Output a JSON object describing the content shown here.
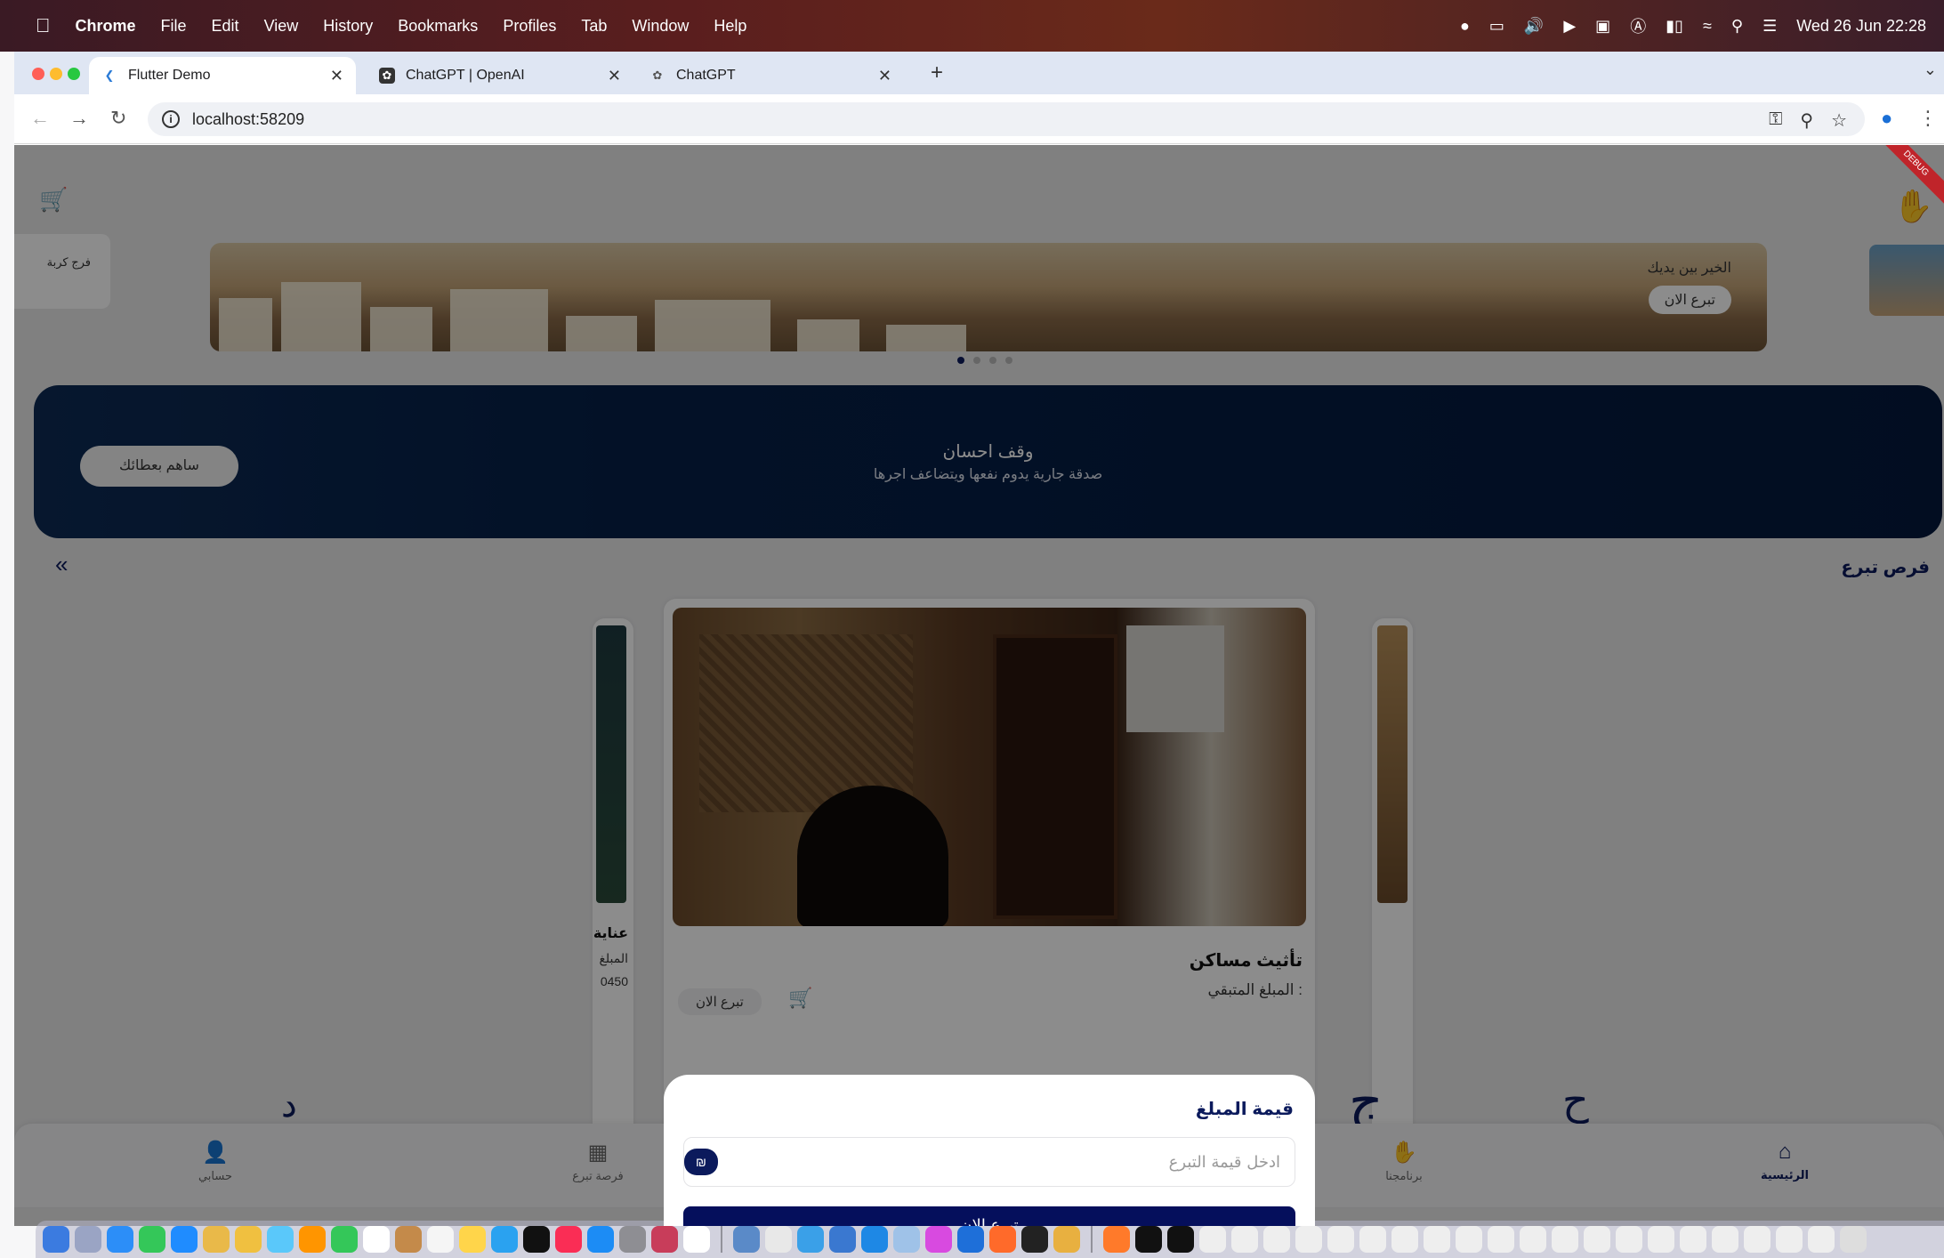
{
  "menubar": {
    "app": "Chrome",
    "items": [
      "File",
      "Edit",
      "View",
      "History",
      "Bookmarks",
      "Profiles",
      "Tab",
      "Window",
      "Help"
    ],
    "clock": "Wed 26 Jun  22:28"
  },
  "browser": {
    "tabs": [
      {
        "title": "Flutter Demo",
        "active": true
      },
      {
        "title": "ChatGPT | OpenAI",
        "active": false
      },
      {
        "title": "ChatGPT",
        "active": false
      }
    ],
    "url": "localhost:58209"
  },
  "page": {
    "banner": {
      "text": "الخير بين يديك",
      "button": "تبرع الان",
      "left_card_text": "فرج كربة"
    },
    "waqf": {
      "title": "وقف احسان",
      "subtitle": "صدقة جارية يدوم نفعها ويتضاعف اجرها",
      "button": "ساهم بعطائك"
    },
    "section_label": "فرص تبرع",
    "main_card": {
      "title": "تأثيث مساكن",
      "remaining_label": "المبلغ المتبقي :",
      "donate_label": "تبرع الان"
    },
    "left_card": {
      "title": "عناية",
      "line1": "المبلغ",
      "line2": "0450"
    },
    "bottom_nav": [
      {
        "label": "حسابي",
        "icon": "person-icon"
      },
      {
        "label": "فرصة تبرع",
        "icon": "grid-icon"
      },
      {
        "label": "برنامجنا",
        "icon": "hand-heart-icon"
      },
      {
        "label": "الرئيسية",
        "icon": "home-icon"
      }
    ],
    "sheet": {
      "title": "قيمة المبلغ",
      "placeholder": "ادخل قيمة التبرع",
      "currency": "₪",
      "button": "تبرع الان"
    },
    "debug_ribbon": "DEBUG"
  },
  "colors": {
    "primary": "#0b1a5c",
    "button": "#050f5c",
    "waqf_bg": "#04193d"
  }
}
